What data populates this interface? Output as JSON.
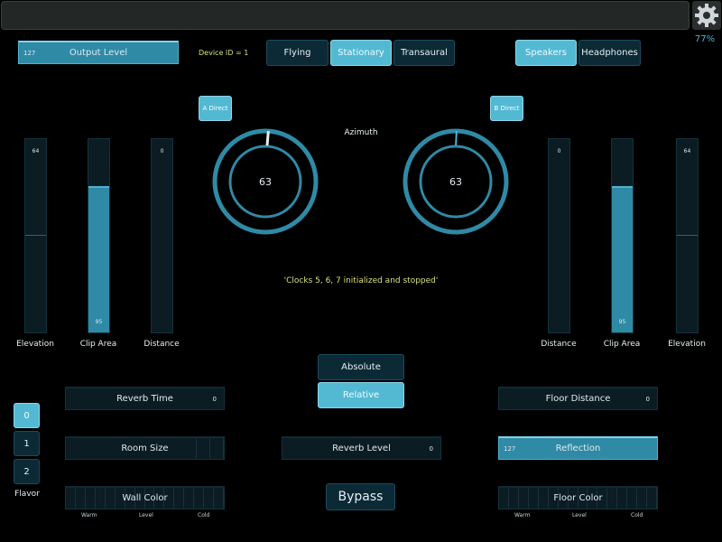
{
  "top": {
    "battery": "77%"
  },
  "output_level": {
    "label": "Output Level",
    "value": "127",
    "fill": 1.0
  },
  "device_id": "Device ID = 1",
  "mode_tabs": [
    {
      "label": "Flying",
      "active": false
    },
    {
      "label": "Stationary",
      "active": true
    },
    {
      "label": "Transaural",
      "active": false
    }
  ],
  "output_tabs": [
    {
      "label": "Speakers",
      "active": true
    },
    {
      "label": "Headphones",
      "active": false
    }
  ],
  "a_direct": "A Direct",
  "b_direct": "B Direct",
  "azimuth_label": "Azimuth",
  "dial_a": {
    "value": "63"
  },
  "dial_b": {
    "value": "63"
  },
  "status_message": "'Clocks 5, 6, 7 initialized and stopped'",
  "left_faders": [
    {
      "label": "Elevation",
      "value": "64",
      "fill": 0.5
    },
    {
      "label": "Clip Area",
      "value": "95",
      "fill": 0.75
    },
    {
      "label": "Distance",
      "value": "0",
      "fill": 0.0
    }
  ],
  "right_faders": [
    {
      "label": "Distance",
      "value": "0",
      "fill": 0.0
    },
    {
      "label": "Clip Area",
      "value": "95",
      "fill": 0.75
    },
    {
      "label": "Elevation",
      "value": "64",
      "fill": 0.5
    }
  ],
  "mode_buttons": [
    {
      "label": "Absolute",
      "active": false
    },
    {
      "label": "Relative",
      "active": true
    }
  ],
  "reverb_time": {
    "label": "Reverb Time",
    "value": "0"
  },
  "room_size": {
    "label": "Room Size"
  },
  "wall_color": {
    "label": "Wall Color",
    "ticks": [
      "Warm",
      "Level",
      "Cold"
    ]
  },
  "reverb_level": {
    "label": "Reverb Level",
    "value": "0"
  },
  "bypass": "Bypass",
  "floor_distance": {
    "label": "Floor Distance",
    "value": "0"
  },
  "reflection": {
    "label": "Reflection",
    "value": "127"
  },
  "floor_color": {
    "label": "Floor Color",
    "ticks": [
      "Warm",
      "Level",
      "Cold"
    ]
  },
  "flavor": {
    "label": "Flavor",
    "options": [
      "0",
      "1",
      "2"
    ],
    "selected": "0"
  }
}
